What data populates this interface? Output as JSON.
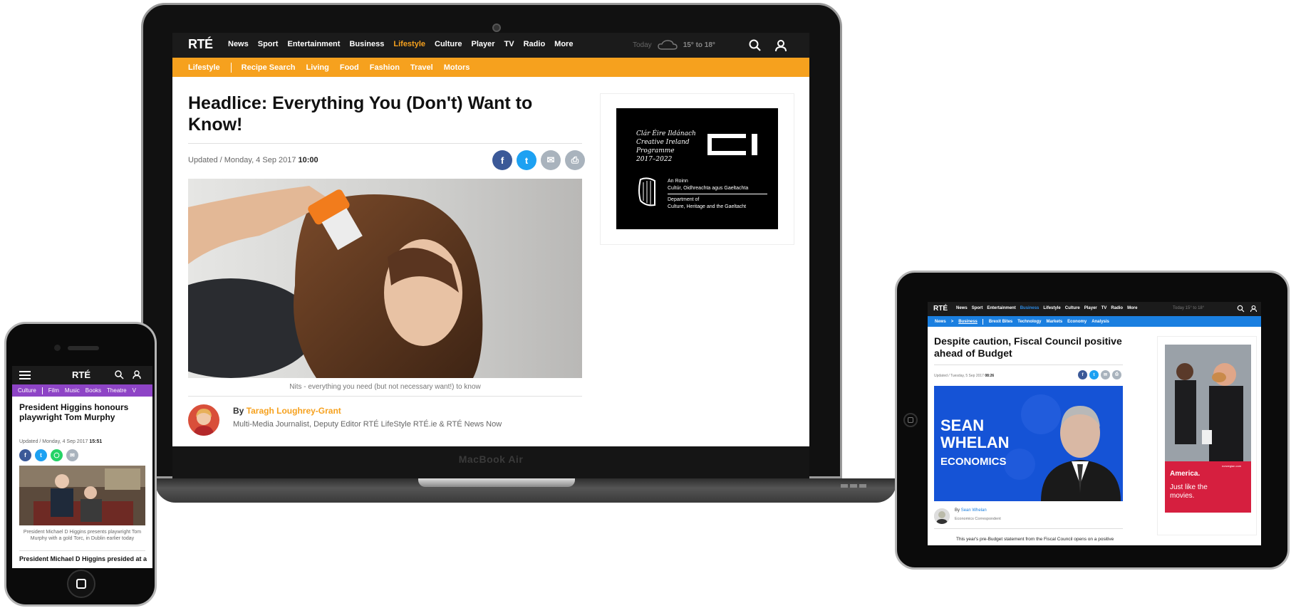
{
  "laptop": {
    "device_label": "MacBook Air",
    "site": {
      "logo": "RTÉ",
      "nav": [
        "News",
        "Sport",
        "Entertainment",
        "Business",
        "Lifestyle",
        "Culture",
        "Player",
        "TV",
        "Radio",
        "More"
      ],
      "active_nav": "Lifestyle",
      "weather": {
        "label": "Today",
        "temp": "15° to 18°"
      },
      "subnav": {
        "section": "Lifestyle",
        "items": [
          "Recipe Search",
          "Living",
          "Food",
          "Fashion",
          "Travel",
          "Motors"
        ]
      },
      "article": {
        "title": "Headlice: Everything You (Don't) Want to Know!",
        "updated_prefix": "Updated / Monday, 4 Sep 2017",
        "updated_time": "10:00",
        "caption": "Nits - everything you need (but not necessary want!) to know",
        "by": "By",
        "author": "Taragh Loughrey-Grant",
        "author_role": "Multi-Media Journalist, Deputy Editor RTÉ LifeStyle RTÉ.ie & RTÉ News Now"
      },
      "ad": {
        "line1": "Clár Éire Ildánach",
        "line2": "Creative Ireland",
        "line3": "Programme",
        "line4": "2017–2022",
        "dept1": "An Roinn",
        "dept2": "Cultúr, Oidhreachta agus Gaeltachta",
        "dept3": "Department of",
        "dept4": "Culture, Heritage and the Gaeltacht"
      }
    }
  },
  "share_icons": [
    "f",
    "t",
    "✉",
    "⎙"
  ],
  "colors": {
    "lifestyle": "#f6a11e",
    "culture": "#8e44c6",
    "business": "#1a7fe0",
    "facebook": "#3b5998",
    "twitter": "#1da1f2",
    "whatsapp": "#25d366",
    "grey": "#a9b3bd"
  },
  "phone": {
    "logo": "RTÉ",
    "subnav": {
      "section": "Culture",
      "items": [
        "Film",
        "Music",
        "Books",
        "Theatre",
        "V"
      ]
    },
    "article": {
      "title": "President Higgins honours playwright Tom Murphy",
      "updated_prefix": "Updated / Monday, 4 Sep 2017",
      "updated_time": "15:51",
      "caption": "President Michael D Higgins presents playwright Tom Murphy with a gold Torc, in Dublin earlier today",
      "body": "President Michael D Higgins presided at a"
    }
  },
  "tablet": {
    "site": {
      "logo": "RTÉ",
      "nav": [
        "News",
        "Sport",
        "Entertainment",
        "Business",
        "Lifestyle",
        "Culture",
        "Player",
        "TV",
        "Radio",
        "More"
      ],
      "active_nav": "Business",
      "weather": "Today  15° to 18°",
      "subnav": {
        "crumb1": "News",
        "sep": ">",
        "crumb2": "Business",
        "items": [
          "Brexit Bites",
          "Technology",
          "Markets",
          "Economy",
          "Analysis"
        ]
      },
      "article": {
        "title": "Despite caution, Fiscal Council positive ahead of Budget",
        "updated_prefix": "Updated / Tuesday, 5 Sep 2017",
        "updated_time": "08:26",
        "hero_name": "SEAN WHELAN",
        "hero_sub": "ECONOMICS",
        "by": "By",
        "author": "Sean Whelan",
        "author_role": "Economics Correspondent",
        "body": "This year's pre-Budget statement from the Fiscal Council opens on a positive"
      },
      "ad": {
        "headline": "America.",
        "sub": "Just like the movies.",
        "tiny": "norwegian.com"
      }
    }
  }
}
